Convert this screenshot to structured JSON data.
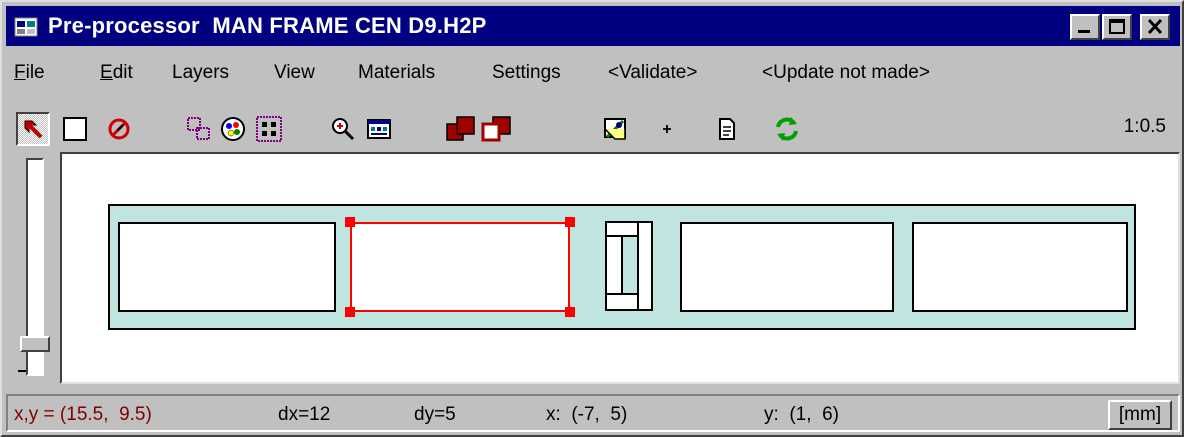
{
  "window": {
    "app_name": "Pre-processor",
    "file_name": "MAN FRAME CEN D9.H2P",
    "controls": [
      "minimize",
      "maximize",
      "close"
    ]
  },
  "menu": {
    "items": [
      {
        "label": "File",
        "underline": "F",
        "rest": "ile"
      },
      {
        "label": "Edit",
        "underline": "E",
        "rest": "dit"
      },
      {
        "label": "Layers"
      },
      {
        "label": "View"
      },
      {
        "label": "Materials"
      },
      {
        "label": "Settings"
      },
      {
        "label": "<Validate>"
      },
      {
        "label": "<Update not made>"
      }
    ]
  },
  "toolbar": {
    "tools": [
      "select-pointer-icon",
      "rectangle-icon",
      "delete-no-icon",
      "layers-icon",
      "materials-palette-icon",
      "grid-points-icon",
      "zoom-in-icon",
      "view-window-icon",
      "filled-squares-icon",
      "outline-squares-icon",
      "export-icon",
      "plus-icon",
      "document-icon",
      "refresh-icon"
    ],
    "scale": "1:0.5"
  },
  "status": {
    "coords": "x,y = (15.5,  9.5)",
    "dx": "dx=12",
    "dy": "dy=5",
    "x_range": "x:  (-7,  5)",
    "y_range": "y:  (1,  6)",
    "units": "[mm]"
  },
  "colors": {
    "title_bar": "#000080",
    "frame_fill": "#c0e4e0",
    "selection": "#ff0000",
    "status_text": "#800000"
  }
}
